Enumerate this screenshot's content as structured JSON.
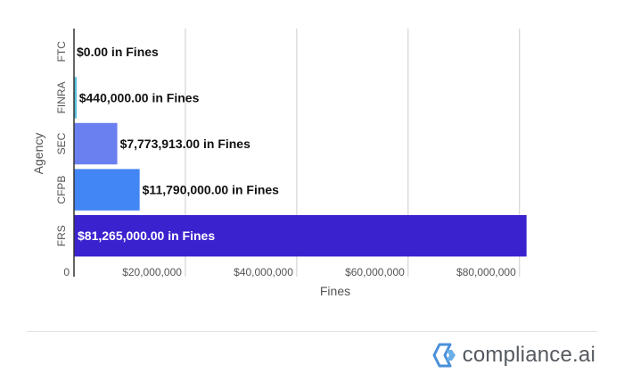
{
  "chart_data": {
    "type": "bar",
    "orientation": "horizontal",
    "categories": [
      "FTC",
      "FINRA",
      "SEC",
      "CFPB",
      "FRS"
    ],
    "values": [
      0,
      440000,
      7773913,
      11790000,
      81265000
    ],
    "data_labels": [
      "$0.00 in Fines",
      "$440,000.00 in Fines",
      "$7,773,913.00 in Fines",
      "$11,790,000.00 in Fines",
      "$81,265,000.00 in Fines"
    ],
    "bar_colors": [
      "#4285f4",
      "#5bc0de",
      "#6a7ff0",
      "#4285f4",
      "#3b22cf"
    ],
    "label_colors": [
      "#111111",
      "#111111",
      "#111111",
      "#111111",
      "#ffffff"
    ],
    "xlabel": "Fines",
    "ylabel": "Agency",
    "xlim": [
      0,
      85000000
    ],
    "x_ticks": [
      0,
      20000000,
      40000000,
      60000000,
      80000000
    ],
    "x_tick_labels": [
      "0",
      "$20,000,000",
      "$40,000,000",
      "$60,000,000",
      "$80,000,000"
    ],
    "grid": true
  },
  "footer": {
    "brand": "compliance.ai",
    "logo_icon": "compliance-ai-logo-icon",
    "logo_colors": [
      "#4a90d9",
      "#6aaee8"
    ]
  }
}
